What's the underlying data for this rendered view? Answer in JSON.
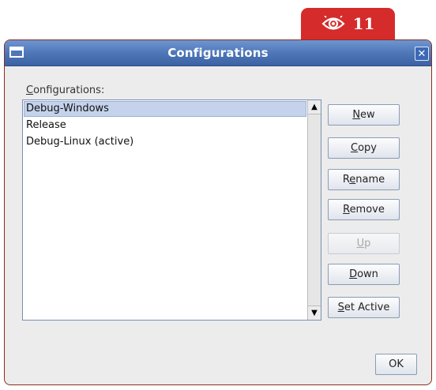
{
  "badge": {
    "icon": "eye-icon",
    "number": "11",
    "color": "#d62b2b"
  },
  "window": {
    "title": "Configurations",
    "system_icon": "window-menu-icon",
    "close_icon": "close-icon",
    "titlebar_color": "#4f77b8"
  },
  "list": {
    "label_mnemonic": "C",
    "label_rest": "onfigurations:",
    "items": [
      {
        "label": "Debug-Windows",
        "selected": true
      },
      {
        "label": "Release",
        "selected": false
      },
      {
        "label": "Debug-Linux (active)",
        "selected": false
      }
    ],
    "scroll_up_icon": "scroll-up-arrow-icon",
    "scroll_down_icon": "scroll-down-arrow-icon"
  },
  "buttons": {
    "new": {
      "mnemonic": "N",
      "rest": "ew",
      "pre": ""
    },
    "copy": {
      "mnemonic": "C",
      "rest": "opy",
      "pre": ""
    },
    "rename": {
      "pre": "R",
      "mnemonic": "e",
      "rest": "name"
    },
    "remove": {
      "mnemonic": "R",
      "rest": "emove",
      "pre": ""
    },
    "up": {
      "mnemonic": "U",
      "rest": "p",
      "pre": "",
      "disabled": true
    },
    "down": {
      "mnemonic": "D",
      "rest": "own",
      "pre": ""
    },
    "set_active": {
      "mnemonic": "S",
      "rest": "et Active",
      "pre": ""
    },
    "ok": {
      "label": "OK"
    }
  }
}
